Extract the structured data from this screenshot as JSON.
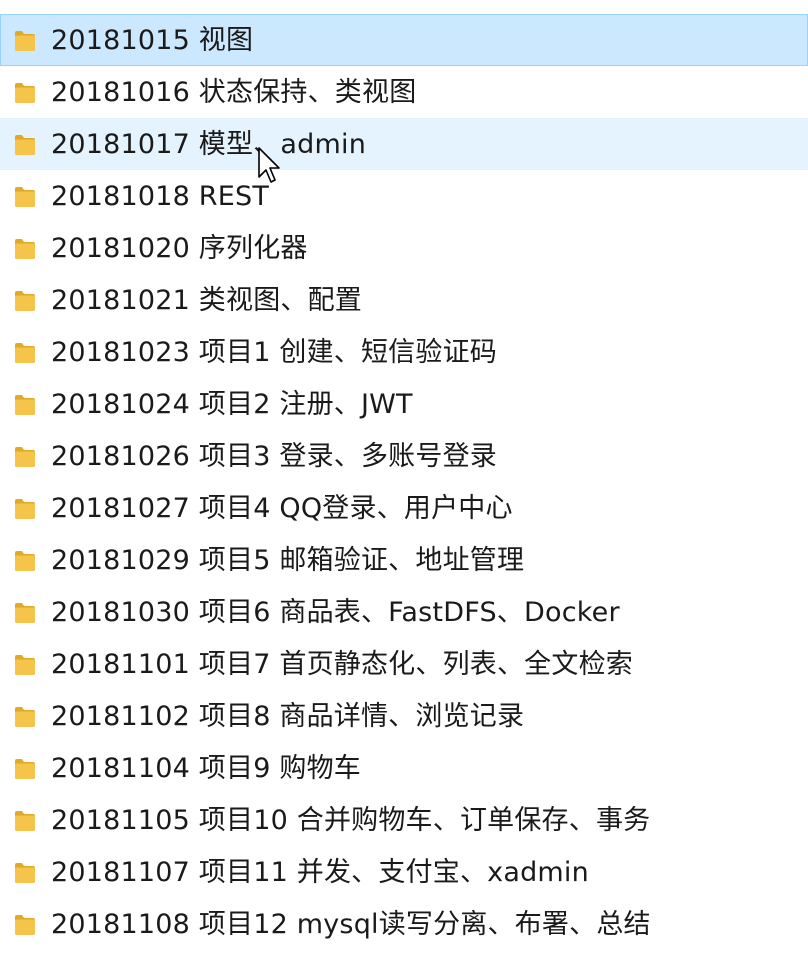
{
  "colors": {
    "selected_bg": "#cce8ff",
    "selected_border": "#99d1ff",
    "hover_bg": "#e5f3ff",
    "folder": "#f5c44a",
    "folder_dark": "#e0a92a"
  },
  "items": [
    {
      "label": "20181015 视图",
      "state": "selected",
      "icon": "folder-icon"
    },
    {
      "label": "20181016 状态保持、类视图",
      "state": "",
      "icon": "folder-icon"
    },
    {
      "label": "20181017 模型、admin",
      "state": "hover",
      "icon": "folder-icon"
    },
    {
      "label": "20181018 REST",
      "state": "",
      "icon": "folder-icon"
    },
    {
      "label": "20181020 序列化器",
      "state": "",
      "icon": "folder-icon"
    },
    {
      "label": "20181021 类视图、配置",
      "state": "",
      "icon": "folder-icon"
    },
    {
      "label": "20181023 项目1 创建、短信验证码",
      "state": "",
      "icon": "folder-icon"
    },
    {
      "label": "20181024 项目2 注册、JWT",
      "state": "",
      "icon": "folder-icon"
    },
    {
      "label": "20181026 项目3 登录、多账号登录",
      "state": "",
      "icon": "folder-icon"
    },
    {
      "label": "20181027 项目4 QQ登录、用户中心",
      "state": "",
      "icon": "folder-icon"
    },
    {
      "label": "20181029 项目5 邮箱验证、地址管理",
      "state": "",
      "icon": "folder-icon"
    },
    {
      "label": "20181030 项目6 商品表、FastDFS、Docker",
      "state": "",
      "icon": "folder-icon"
    },
    {
      "label": "20181101 项目7 首页静态化、列表、全文检索",
      "state": "",
      "icon": "folder-icon"
    },
    {
      "label": "20181102 项目8 商品详情、浏览记录",
      "state": "",
      "icon": "folder-icon"
    },
    {
      "label": "20181104 项目9 购物车",
      "state": "",
      "icon": "folder-icon"
    },
    {
      "label": "20181105 项目10 合并购物车、订单保存、事务",
      "state": "",
      "icon": "folder-icon"
    },
    {
      "label": "20181107 项目11 并发、支付宝、xadmin",
      "state": "",
      "icon": "folder-icon"
    },
    {
      "label": "20181108 项目12 mysql读写分离、布署、总结",
      "state": "",
      "icon": "folder-icon"
    }
  ],
  "cursor": {
    "icon": "mouse-pointer-icon"
  }
}
